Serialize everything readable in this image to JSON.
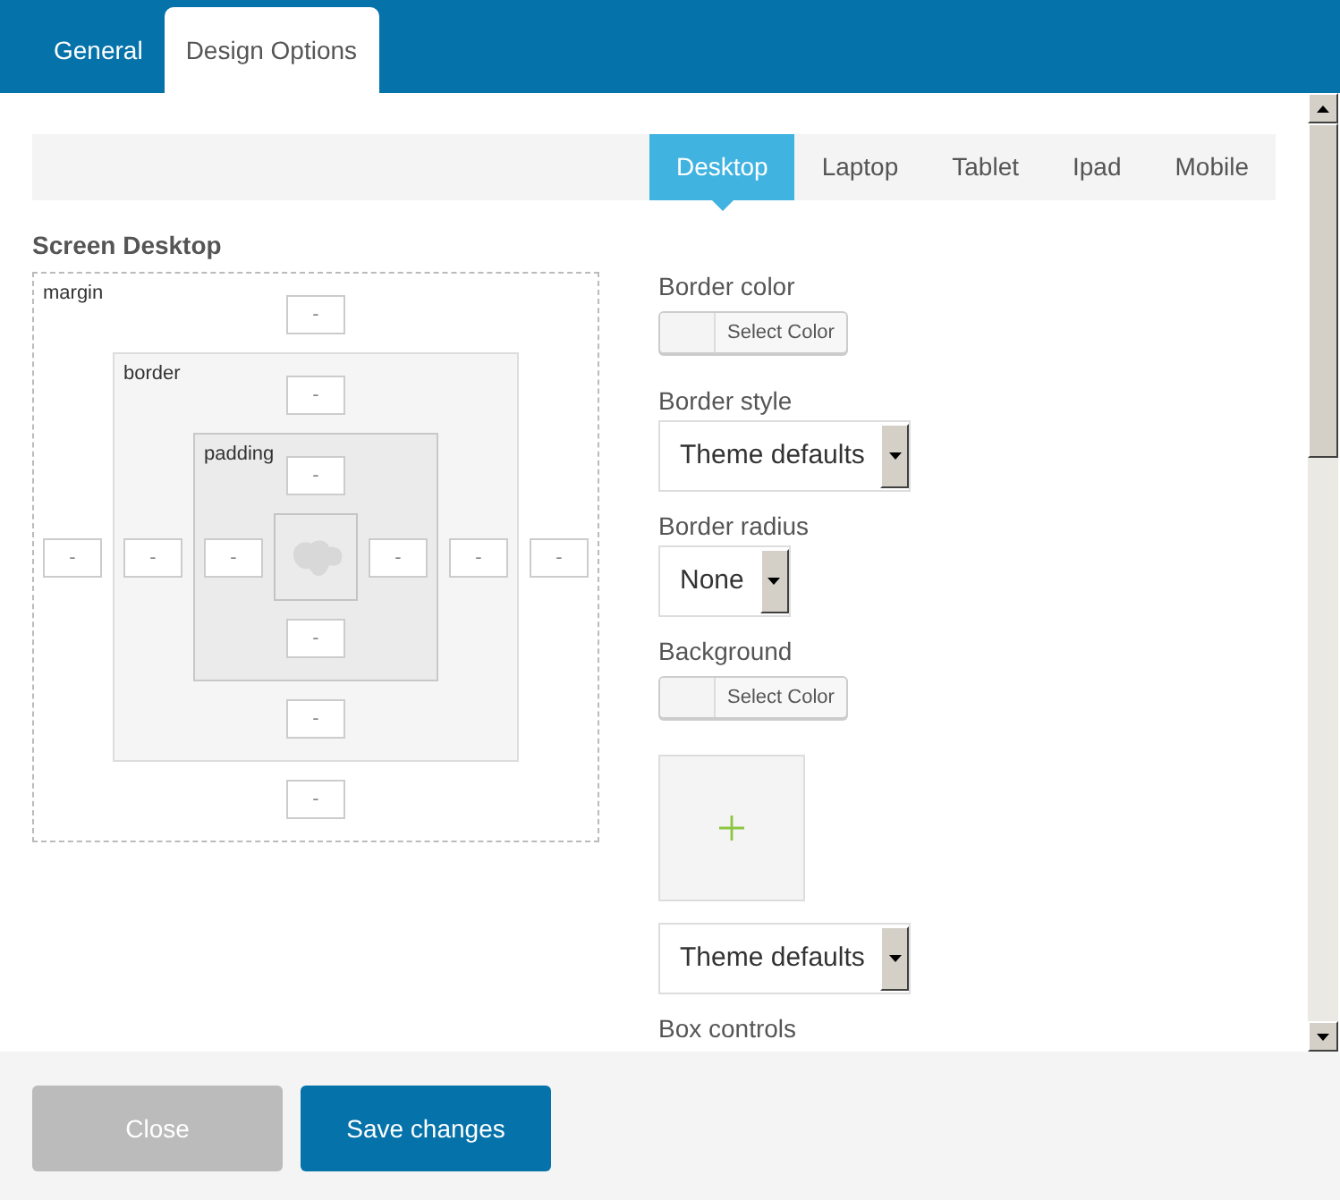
{
  "modal_tabs": [
    {
      "label": "General",
      "selected": false
    },
    {
      "label": "Design Options",
      "selected": true
    }
  ],
  "device_tabs": [
    {
      "label": "Desktop",
      "selected": true
    },
    {
      "label": "Laptop",
      "selected": false
    },
    {
      "label": "Tablet",
      "selected": false
    },
    {
      "label": "Ipad",
      "selected": false
    },
    {
      "label": "Mobile",
      "selected": false
    }
  ],
  "box_model": {
    "title": "Screen Desktop",
    "layers": [
      {
        "label": "margin",
        "top": {
          "placeholder": "-"
        },
        "right": {
          "placeholder": "-"
        },
        "bottom": {
          "placeholder": "-"
        },
        "left": {
          "placeholder": "-"
        }
      },
      {
        "label": "border",
        "top": {
          "placeholder": "-"
        },
        "right": {
          "placeholder": "-"
        },
        "bottom": {
          "placeholder": "-"
        },
        "left": {
          "placeholder": "-"
        }
      },
      {
        "label": "padding",
        "top": {
          "placeholder": "-"
        },
        "right": {
          "placeholder": "-"
        },
        "bottom": {
          "placeholder": "-"
        },
        "left": {
          "placeholder": "-"
        }
      }
    ]
  },
  "fields": [
    {
      "kind": "color",
      "label": "Border color",
      "button": "Select Color"
    },
    {
      "kind": "select",
      "label": "Border style",
      "value": "Theme defaults"
    },
    {
      "kind": "select",
      "label": "Border radius",
      "value": "None"
    },
    {
      "kind": "color",
      "label": "Background",
      "button": "Select Color"
    },
    {
      "kind": "image"
    },
    {
      "kind": "select",
      "value": "Theme defaults"
    },
    {
      "kind": "heading",
      "label": "Box controls"
    }
  ],
  "buttons": [
    {
      "label": "Close",
      "kind": "secondary"
    },
    {
      "label": "Save changes",
      "kind": "primary"
    }
  ]
}
